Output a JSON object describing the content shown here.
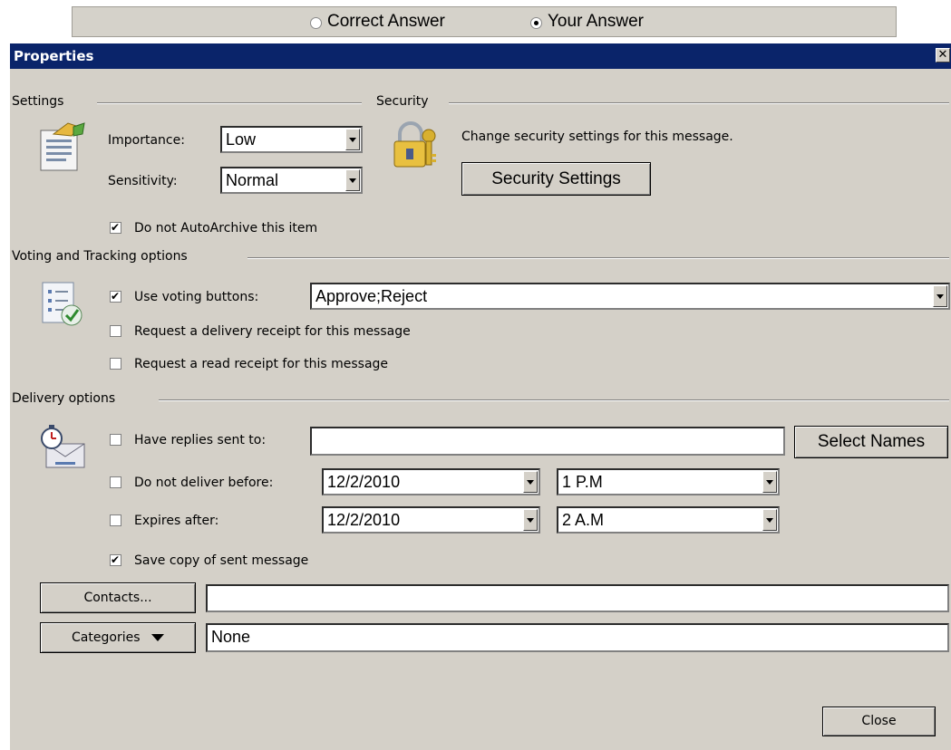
{
  "answer_bar": {
    "options": [
      {
        "label": "Correct Answer",
        "selected": false
      },
      {
        "label": "Your Answer",
        "selected": true
      }
    ]
  },
  "dialog": {
    "title": "Properties",
    "close_glyph": "✕",
    "settings": {
      "group_label": "Settings",
      "importance_label": "Importance:",
      "importance_value": "Low",
      "sensitivity_label": "Sensitivity:",
      "sensitivity_value": "Normal",
      "autoarchive_label": "Do not AutoArchive this item",
      "autoarchive_checked": true
    },
    "security": {
      "group_label": "Security",
      "description": "Change security settings for this message.",
      "button_label": "Security Settings"
    },
    "voting": {
      "group_label": "Voting and Tracking options",
      "use_voting_label": "Use voting buttons:",
      "use_voting_checked": true,
      "voting_value": "Approve;Reject",
      "delivery_receipt_label": "Request a delivery receipt for this message",
      "delivery_receipt_checked": false,
      "read_receipt_label": "Request a read receipt for this message",
      "read_receipt_checked": false
    },
    "delivery": {
      "group_label": "Delivery options",
      "replies_label": "Have replies sent to:",
      "replies_checked": false,
      "replies_value": "",
      "select_names_label": "Select Names",
      "not_before_label": "Do not deliver before:",
      "not_before_checked": false,
      "not_before_date": "12/2/2010",
      "not_before_time": "1 P.M",
      "expires_label": "Expires after:",
      "expires_checked": false,
      "expires_date": "12/2/2010",
      "expires_time": "2 A.M",
      "save_copy_label": "Save copy of sent message",
      "save_copy_checked": true
    },
    "contacts_button_label": "Contacts...",
    "contacts_value": "",
    "categories_button_label": "Categories",
    "categories_value": "None",
    "close_button_label": "Close"
  }
}
